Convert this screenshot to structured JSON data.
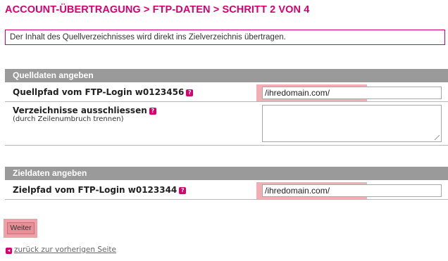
{
  "page": {
    "title": "ACCOUNT-ÜBERTRAGUNG > FTP-DATEN > SCHRITT 2 VON 4",
    "notice": "Der Inhalt des Quellverzeichnisses wird direkt ins Zielverzeichnis übertragen."
  },
  "source_section": {
    "heading": "Quelldaten angeben",
    "path_label": "Quellpfad vom FTP-Login w0123456",
    "path_value": "/ihredomain.com/",
    "exclude_label": "Verzeichnisse ausschliessen",
    "exclude_hint": "(durch Zeilenumbruch trennen)",
    "exclude_value": ""
  },
  "target_section": {
    "heading": "Zieldaten angeben",
    "path_label": "Zielpfad vom FTP-Login w0123344",
    "path_value": "/ihredomain.com/"
  },
  "actions": {
    "submit_label": "Weiter",
    "back_label": "zurück zur vorherigen Seite"
  },
  "icons": {
    "help": "help-question-icon",
    "back": "back-arrow-icon"
  },
  "colors": {
    "accent": "#d6006f",
    "section_header": "#9a9a9a",
    "highlight": "#f0a0a8"
  }
}
